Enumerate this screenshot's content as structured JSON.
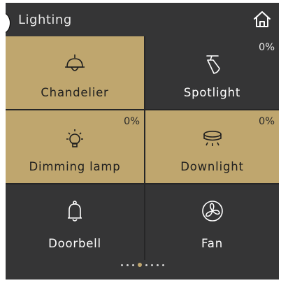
{
  "header": {
    "title": "Lighting",
    "home_icon": "home-icon"
  },
  "tiles": [
    {
      "label": "Chandelier",
      "icon": "chandelier-icon",
      "state": "on",
      "percent": ""
    },
    {
      "label": "Spotlight",
      "icon": "spotlight-icon",
      "state": "off",
      "percent": "0%"
    },
    {
      "label": "Dimming lamp",
      "icon": "bulb-icon",
      "state": "on",
      "percent": "0%"
    },
    {
      "label": "Downlight",
      "icon": "downlight-icon",
      "state": "on",
      "percent": "0%"
    },
    {
      "label": "Doorbell",
      "icon": "bell-icon",
      "state": "off",
      "percent": ""
    },
    {
      "label": "Fan",
      "icon": "fan-icon",
      "state": "off",
      "percent": ""
    }
  ],
  "pager": {
    "total": 8,
    "active": 3
  },
  "colors": {
    "background": "#353536",
    "tile_on": "#bfa66e",
    "text": "#ffffff",
    "active_dot": "#bfa66e"
  }
}
